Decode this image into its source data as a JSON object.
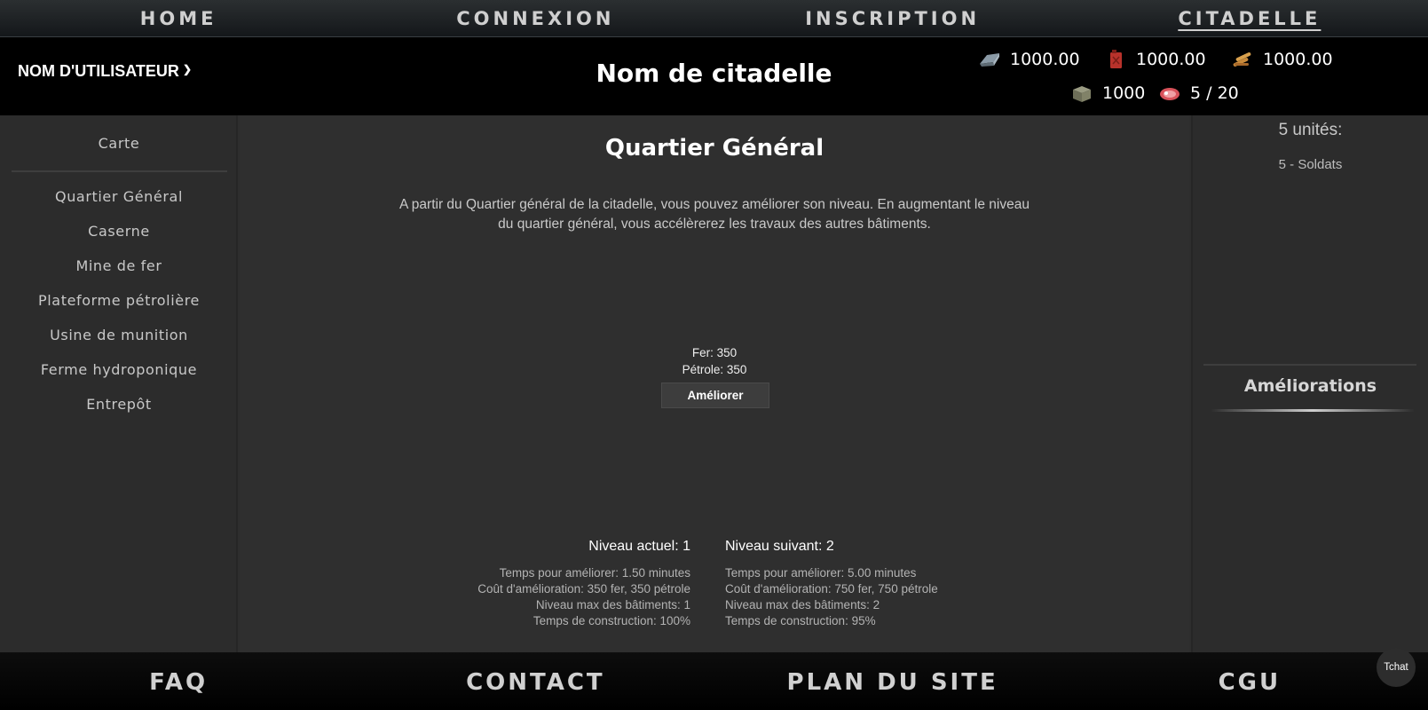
{
  "topnav": {
    "home": "HOME",
    "connexion": "CONNEXION",
    "inscription": "INSCRIPTION",
    "citadelle": "CITADELLE"
  },
  "header": {
    "username": "NOM D'UTILISATEUR",
    "citadel_name": "Nom de citadelle",
    "resources": {
      "iron": "1000.00",
      "oil": "1000.00",
      "ammo": "1000.00",
      "storage": "1000",
      "food": "5 / 20"
    },
    "icons": {
      "iron": "iron-ingot-icon",
      "oil": "jerrycan-icon",
      "ammo": "ammunition-icon",
      "storage": "crate-icon",
      "food": "steak-icon"
    }
  },
  "sidebar": {
    "map": "Carte",
    "items": [
      "Quartier Général",
      "Caserne",
      "Mine de fer",
      "Plateforme pétrolière",
      "Usine de munition",
      "Ferme hydroponique",
      "Entrepôt"
    ]
  },
  "main": {
    "title": "Quartier Général",
    "description": "A partir du Quartier général de la citadelle, vous pouvez améliorer son niveau. En augmentant le niveau du quartier général, vous accélèrerez les travaux des autres bâtiments.",
    "cost_iron": "Fer: 350",
    "cost_oil": "Pétrole: 350",
    "upgrade_label": "Améliorer",
    "current": {
      "title": "Niveau actuel: 1",
      "lines": [
        "Temps pour améliorer: 1.50 minutes",
        "Coût d'amélioration: 350 fer, 350 pétrole",
        "Niveau max des bâtiments: 1",
        "Temps de construction: 100%"
      ]
    },
    "next": {
      "title": "Niveau suivant: 2",
      "lines": [
        "Temps pour améliorer: 5.00 minutes",
        "Coût d'amélioration: 750 fer, 750 pétrole",
        "Niveau max des bâtiments: 2",
        "Temps de construction: 95%"
      ]
    }
  },
  "rightbar": {
    "units_title": "5 unités:",
    "units": [
      "5 - Soldats"
    ],
    "upgrades_title": "Améliorations"
  },
  "footer": {
    "faq": "FAQ",
    "contact": "CONTACT",
    "sitemap": "PLAN DU SITE",
    "cgu": "CGU"
  },
  "chat": "Tchat"
}
